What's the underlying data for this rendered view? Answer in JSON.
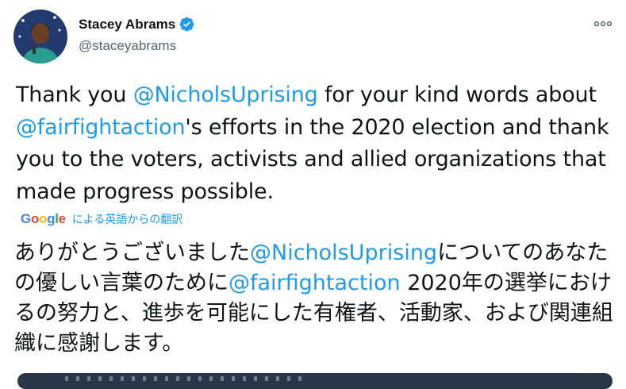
{
  "author": {
    "display_name": "Stacey Abrams",
    "handle": "@staceyabrams",
    "verified_icon": "verified-badge-icon",
    "avatar_icon": "profile-photo"
  },
  "more_icon": "more-options-icon",
  "tweet": {
    "part1": "Thank you ",
    "mention1": "@NicholsUprising",
    "part2": " for your kind words about ",
    "mention2": "@fairfightaction",
    "part3": "'s efforts in the 2020 election and thank you to the voters, activists and allied organizations that made progress possible."
  },
  "translation": {
    "provider": "Google",
    "label": "による英語からの翻訳",
    "part1": "ありがとうございました",
    "mention1": "@NicholsUprising",
    "part2": "についてのあなたの優しい言葉のために",
    "mention2": "@fairfightaction",
    "part3": " 2020年の選挙におけるの努力と、進歩を可能にした有権者、活動家、および関連組織に感謝します。"
  },
  "colors": {
    "link": "#1d9bf0",
    "text": "#0f1419",
    "secondary": "#536471",
    "verified": "#1d9bf0"
  }
}
